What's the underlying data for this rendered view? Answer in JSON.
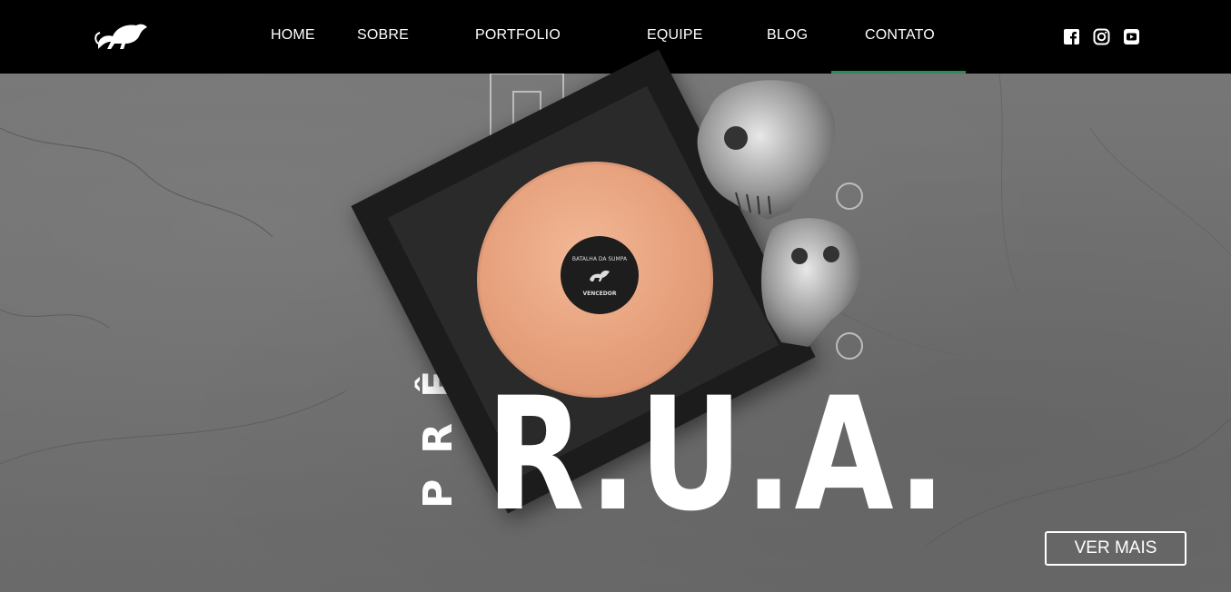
{
  "nav": {
    "items": [
      {
        "label": "HOME"
      },
      {
        "label": "SOBRE"
      },
      {
        "label": "PORTFOLIO"
      },
      {
        "label": "EQUIPE"
      },
      {
        "label": "BLOG"
      },
      {
        "label": "CONTATO"
      }
    ],
    "active_index": 5,
    "active_color": "#2e8b57"
  },
  "social": [
    "facebook-icon",
    "instagram-icon",
    "youtube-icon"
  ],
  "hero": {
    "vertical_title": "PRÊMIO",
    "title": "R.U.A.",
    "record_label_top": "BATALHA DA SUMPA",
    "record_label_bottom": "VENCEDOR",
    "button_label": "VER MAIS"
  }
}
